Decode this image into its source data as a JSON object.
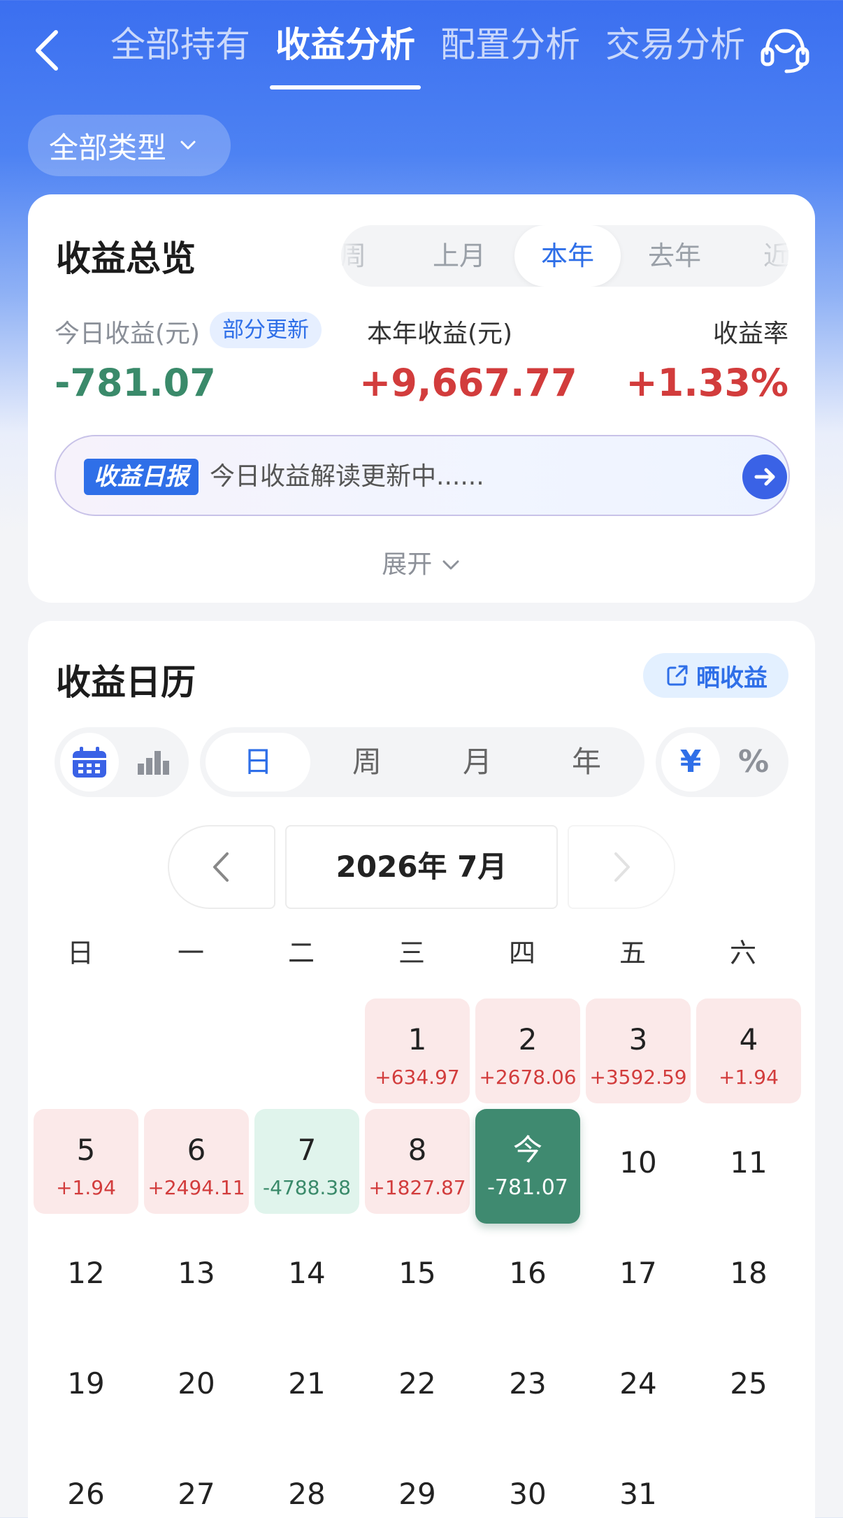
{
  "nav": {
    "tabs": [
      "全部持有",
      "收益分析",
      "配置分析",
      "交易分析"
    ],
    "active_tab": 1
  },
  "filter": {
    "label": "全部类型"
  },
  "overview": {
    "title": "收益总览",
    "periods": [
      "周",
      "上月",
      "本年",
      "去年",
      "近"
    ],
    "active_period": "本年",
    "today_label": "今日收益(元)",
    "update_badge": "部分更新",
    "today_value": "-781.07",
    "year_label": "本年收益(元)",
    "year_value": "+9,667.77",
    "rate_label": "收益率",
    "rate_value": "+1.33%",
    "report_tag": "收益日报",
    "report_text": "今日收益解读更新中......",
    "expand_label": "展开"
  },
  "calendar": {
    "title": "收益日历",
    "share_label": "晒收益",
    "view_icons": [
      "calendar-icon",
      "bar-chart-icon"
    ],
    "granularity": [
      "日",
      "周",
      "月",
      "年"
    ],
    "active_granularity": "日",
    "units": [
      "¥",
      "%"
    ],
    "active_unit": "¥",
    "month_label": "2026年 7月",
    "weekdays": [
      "日",
      "一",
      "二",
      "三",
      "四",
      "五",
      "六"
    ],
    "days": [
      {
        "num": "1",
        "amt": "+634.97",
        "type": "gain"
      },
      {
        "num": "2",
        "amt": "+2678.06",
        "type": "gain"
      },
      {
        "num": "3",
        "amt": "+3592.59",
        "type": "gain"
      },
      {
        "num": "4",
        "amt": "+1.94",
        "type": "gain"
      },
      {
        "num": "5",
        "amt": "+1.94",
        "type": "gain"
      },
      {
        "num": "6",
        "amt": "+2494.11",
        "type": "gain"
      },
      {
        "num": "7",
        "amt": "-4788.38",
        "type": "loss"
      },
      {
        "num": "8",
        "amt": "+1827.87",
        "type": "gain"
      },
      {
        "num": "今",
        "amt": "-781.07",
        "type": "today"
      },
      {
        "num": "10",
        "amt": "",
        "type": "plain"
      },
      {
        "num": "11",
        "amt": "",
        "type": "plain"
      },
      {
        "num": "12",
        "amt": "",
        "type": "plain"
      },
      {
        "num": "13",
        "amt": "",
        "type": "plain"
      },
      {
        "num": "14",
        "amt": "",
        "type": "plain"
      },
      {
        "num": "15",
        "amt": "",
        "type": "plain"
      },
      {
        "num": "16",
        "amt": "",
        "type": "plain"
      },
      {
        "num": "17",
        "amt": "",
        "type": "plain"
      },
      {
        "num": "18",
        "amt": "",
        "type": "plain"
      },
      {
        "num": "19",
        "amt": "",
        "type": "plain"
      },
      {
        "num": "20",
        "amt": "",
        "type": "plain"
      },
      {
        "num": "21",
        "amt": "",
        "type": "plain"
      },
      {
        "num": "22",
        "amt": "",
        "type": "plain"
      },
      {
        "num": "23",
        "amt": "",
        "type": "plain"
      },
      {
        "num": "24",
        "amt": "",
        "type": "plain"
      },
      {
        "num": "25",
        "amt": "",
        "type": "plain"
      },
      {
        "num": "26",
        "amt": "",
        "type": "plain"
      },
      {
        "num": "27",
        "amt": "",
        "type": "plain"
      },
      {
        "num": "28",
        "amt": "",
        "type": "plain"
      },
      {
        "num": "29",
        "amt": "",
        "type": "plain"
      },
      {
        "num": "30",
        "amt": "",
        "type": "plain"
      },
      {
        "num": "31",
        "amt": "",
        "type": "plain"
      }
    ]
  },
  "colors": {
    "accent": "#2f6fe8",
    "gain": "#d23c3c",
    "loss": "#3a8a6a",
    "today_bg": "#3f8a70"
  }
}
